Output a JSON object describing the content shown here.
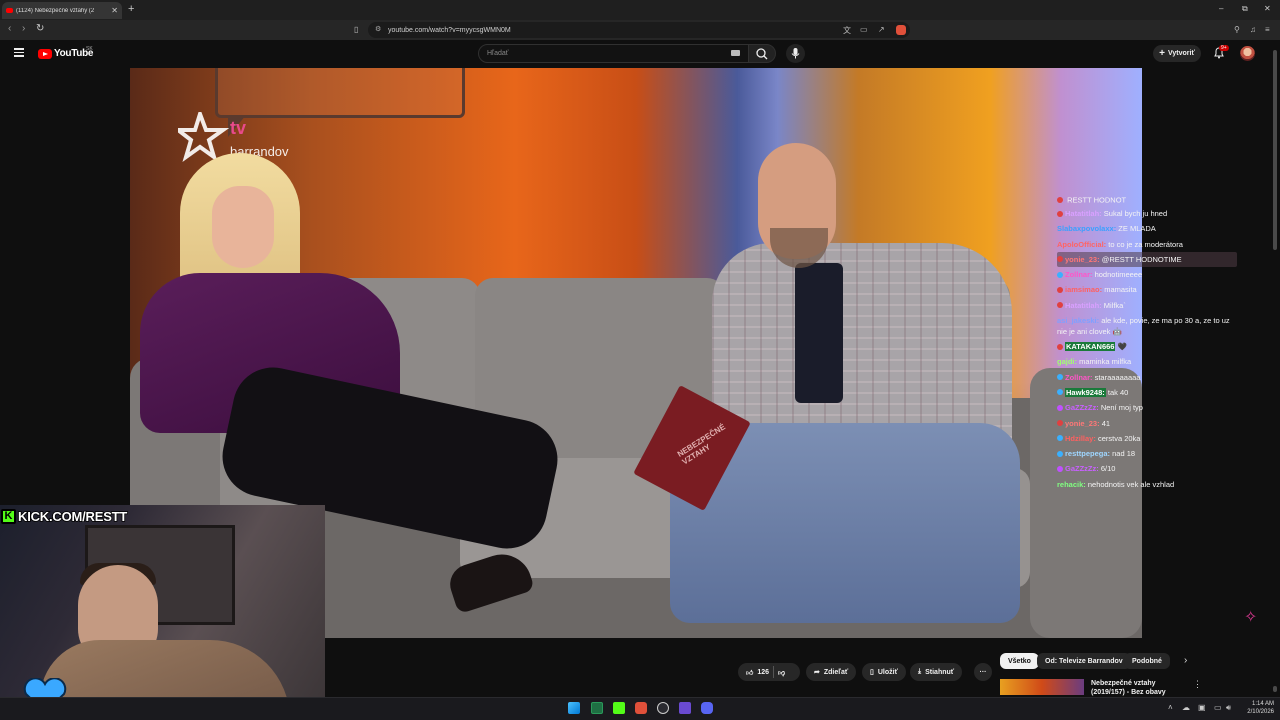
{
  "browser": {
    "tab_title": "(1124) Nebezpečné vztahy (2",
    "tab_close": "✕",
    "new_tab": "+",
    "url": "youtube.com/watch?v=myycsgWMN0M",
    "window_controls": [
      "–",
      "⧉",
      "✕"
    ]
  },
  "youtube": {
    "logo_text": "YouTube",
    "country_code": "SK",
    "search_placeholder": "Hľadať",
    "create_label": "Vytvoriť",
    "notification_count": "9+",
    "accent_color": "#ff0000"
  },
  "video": {
    "station_logo": "tv barrandov",
    "booklet_text": "NEBEZPEČNÉ VZTAHY"
  },
  "chat": [
    {
      "user": "",
      "user_color": "#ffffff",
      "message": "RESTT HODNOT",
      "badge": "#e04040",
      "partial": true
    },
    {
      "user": "Hatatitlah:",
      "user_color": "#d9a0ff",
      "message": "Sukal bych ju hned",
      "badge": "#e04040"
    },
    {
      "user": "Slabaxpovolaxx:",
      "user_color": "#3aa0ff",
      "message": "ZE MLADA",
      "badge": ""
    },
    {
      "user": "ApoloOfficial:",
      "user_color": "#ff6464",
      "message": "to co je za moderátora",
      "badge": ""
    },
    {
      "user": "yonie_23:",
      "user_color": "#ff7777",
      "message": "@RESTT HODNOTIME",
      "badge": "#e04040",
      "highlight": true
    },
    {
      "user": "Zollnar:",
      "user_color": "#ff55c8",
      "message": "hodnotimeeee",
      "badge": "#3ab0ff"
    },
    {
      "user": "iamsimao:",
      "user_color": "#ff6060",
      "message": "mamasita",
      "badge": "#e04040"
    },
    {
      "user": "Hatatitlah:",
      "user_color": "#d9a0ff",
      "message": "Milfka`",
      "badge": "#e04040"
    },
    {
      "user": "asi_jakeski:",
      "user_color": "#7fa0ff",
      "message": "ale kde, povie, ze ma po 30 a, ze to uz nie je ani clovek 🤖",
      "badge": "",
      "wrap": true
    },
    {
      "user": "KATAKAN666",
      "user_color": "#ffffff",
      "message": "🖤",
      "badge": "#e04040",
      "tagged": true
    },
    {
      "user": "gajdi:",
      "user_color": "#a0ff70",
      "message": "maminka milfka",
      "badge": ""
    },
    {
      "user": "Zollnar:",
      "user_color": "#ff55c8",
      "message": "staraaaaaaaa",
      "badge": "#3ab0ff"
    },
    {
      "user": "Hawk9248:",
      "user_color": "#ffffff",
      "message": "tak 40",
      "badge": "#3ab0ff",
      "tagged": true
    },
    {
      "user": "GaZZzZz:",
      "user_color": "#c860ff",
      "message": "Není moj typ",
      "badge": "#c050ff"
    },
    {
      "user": "yonie_23:",
      "user_color": "#ff7777",
      "message": "41",
      "badge": "#e04040"
    },
    {
      "user": "Hdzillay:",
      "user_color": "#ff6060",
      "message": "cerstva 20ka",
      "badge": "#3ab0ff"
    },
    {
      "user": "resttpepega:",
      "user_color": "#9fd6ff",
      "message": "nad 18",
      "badge": "#3ab0ff"
    },
    {
      "user": "GaZZzZz:",
      "user_color": "#c860ff",
      "message": "6/10",
      "badge": "#c050ff"
    },
    {
      "user": "rehacik:",
      "user_color": "#80ff80",
      "message": "nehodnotis vek ale vzhlad",
      "badge": ""
    }
  ],
  "stream_overlay": {
    "kick_letter": "K",
    "kick_url": "KICK.COM/RESTT"
  },
  "actions": {
    "like_count": "126",
    "share_label": "Zdieľať",
    "save_label": "Uložiť",
    "download_label": "Stiahnuť",
    "more_label": "···"
  },
  "sidebar": {
    "chips": [
      "Všetko",
      "Od: Televize Barrandov",
      "Podobné"
    ],
    "next_arrow": "›",
    "recommendation_title": "Nebezpečné vztahy (2019/157) - Bez obavy",
    "recommendation_menu": "⋮"
  },
  "taskbar": {
    "time": "1:14 AM",
    "date": "2/10/2026"
  }
}
